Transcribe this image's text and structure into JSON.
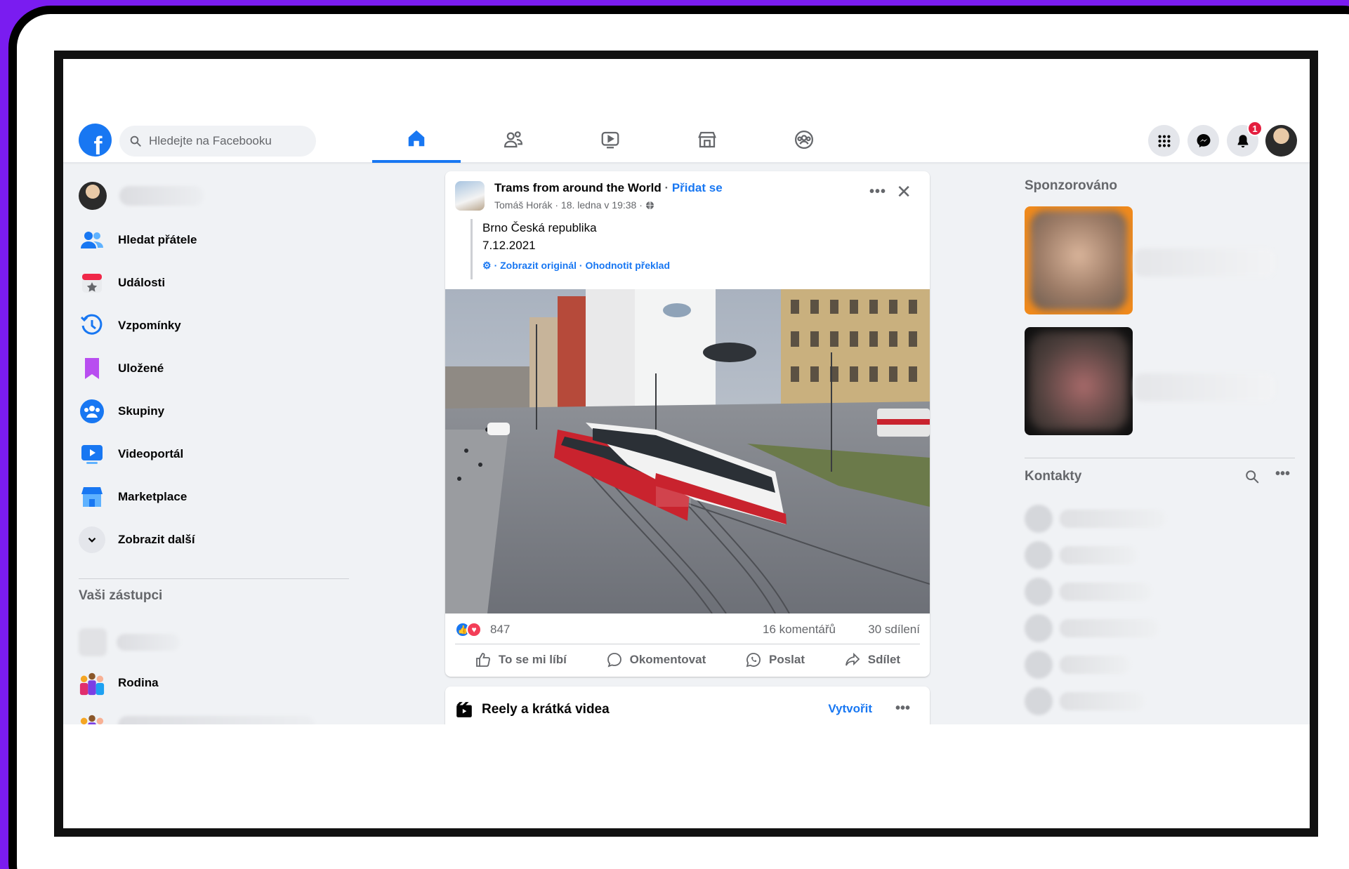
{
  "search": {
    "placeholder": "Hledejte na Facebooku"
  },
  "nav": {
    "tabs": [
      {
        "name": "home",
        "active": true
      },
      {
        "name": "friends",
        "active": false
      },
      {
        "name": "watch",
        "active": false
      },
      {
        "name": "marketplace",
        "active": false
      },
      {
        "name": "groups",
        "active": false
      }
    ],
    "notifications_badge": "1"
  },
  "sidebar": {
    "items": [
      {
        "label": "Hledat přátele",
        "icon": "friends-icon"
      },
      {
        "label": "Události",
        "icon": "calendar-icon"
      },
      {
        "label": "Vzpomínky",
        "icon": "memories-clock-icon"
      },
      {
        "label": "Uložené",
        "icon": "bookmark-icon"
      },
      {
        "label": "Skupiny",
        "icon": "groups-icon"
      },
      {
        "label": "Videoportál",
        "icon": "video-icon"
      },
      {
        "label": "Marketplace",
        "icon": "shop-icon"
      },
      {
        "label": "Zobrazit další",
        "icon": "chevron-down-icon"
      }
    ],
    "representatives_title": "Vaši zástupci",
    "representatives": [
      {
        "label": "Rodina",
        "icon": "family-group-icon"
      }
    ]
  },
  "post": {
    "group_name": "Trams from around the World",
    "join_label": "Přidat se",
    "author_meta": "Tomáš Horák · 18. ledna v 19:38 ·",
    "text_line1": "Brno Česká republika",
    "text_line2": "7.12.2021",
    "translation_links": "· Zobrazit originál · Ohodnotit překlad",
    "reactions_count": "847",
    "comments": "16 komentářů",
    "shares": "30 sdílení",
    "actions": {
      "like": "To se mi líbí",
      "comment": "Okomentovat",
      "send": "Poslat",
      "share": "Sdílet"
    }
  },
  "reels": {
    "title": "Reely a krátká videa",
    "create_label": "Vytvořit"
  },
  "right": {
    "sponsored_title": "Sponzorováno",
    "contacts_title": "Kontakty"
  },
  "colors": {
    "brand": "#1877f2",
    "background": "#f0f2f5",
    "badge": "#e41e3f",
    "frame": "#7a1cf0"
  }
}
